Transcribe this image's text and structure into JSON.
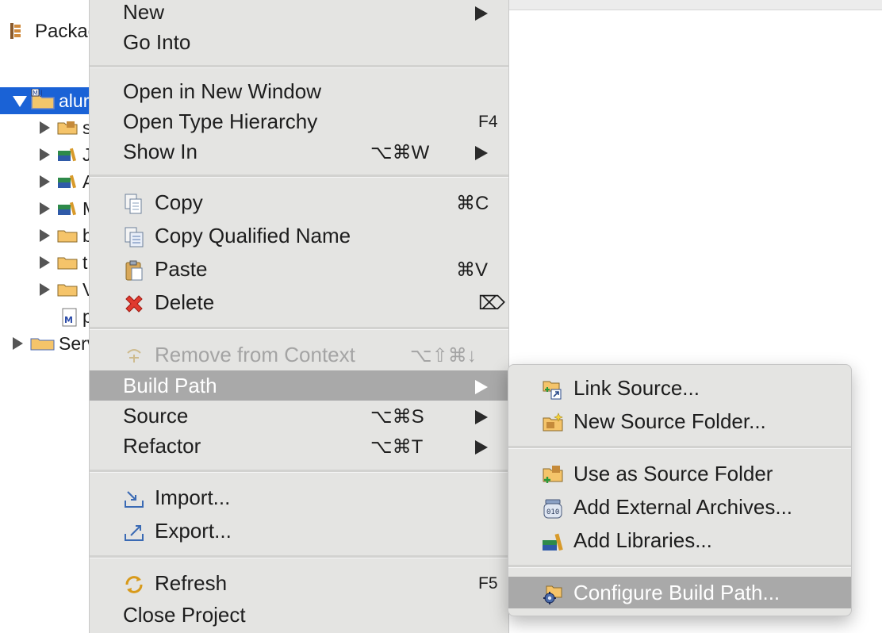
{
  "explorer": {
    "tab_label": "Packag",
    "tree": [
      {
        "text": "alur",
        "expanded": true,
        "selected": true
      },
      {
        "text": "s"
      },
      {
        "text": "J"
      },
      {
        "text": "A"
      },
      {
        "text": "M"
      },
      {
        "text": "b"
      },
      {
        "text": "t"
      },
      {
        "text": "V"
      },
      {
        "text": "p"
      },
      {
        "text": "Serv"
      }
    ]
  },
  "menu": {
    "new": {
      "label": "New"
    },
    "go_into": {
      "label": "Go Into"
    },
    "open_new_window": {
      "label": "Open in New Window"
    },
    "open_type_hierarchy": {
      "label": "Open Type Hierarchy",
      "shortcut": "F4"
    },
    "show_in": {
      "label": "Show In",
      "shortcut": "⌥⌘W"
    },
    "copy": {
      "label": "Copy",
      "shortcut": "⌘C"
    },
    "copy_qualified": {
      "label": "Copy Qualified Name"
    },
    "paste": {
      "label": "Paste",
      "shortcut": "⌘V"
    },
    "delete": {
      "label": "Delete",
      "shortcut": "⌦"
    },
    "remove_context": {
      "label": "Remove from Context",
      "shortcut": "⌥⇧⌘↓"
    },
    "build_path": {
      "label": "Build Path"
    },
    "source": {
      "label": "Source",
      "shortcut": "⌥⌘S"
    },
    "refactor": {
      "label": "Refactor",
      "shortcut": "⌥⌘T"
    },
    "import": {
      "label": "Import..."
    },
    "export": {
      "label": "Export..."
    },
    "refresh": {
      "label": "Refresh",
      "shortcut": "F5"
    },
    "close_project": {
      "label": "Close Project"
    }
  },
  "submenu": {
    "link_source": {
      "label": "Link Source..."
    },
    "new_source_folder": {
      "label": "New Source Folder..."
    },
    "use_as_source": {
      "label": "Use as Source Folder"
    },
    "add_external_archives": {
      "label": "Add External Archives..."
    },
    "add_libraries": {
      "label": "Add Libraries..."
    },
    "configure_build_path": {
      "label": "Configure Build Path..."
    }
  },
  "colors": {
    "selection": "#1a62d6",
    "menu_bg": "#e4e4e2",
    "menu_highlight": "#a9a9a9"
  }
}
